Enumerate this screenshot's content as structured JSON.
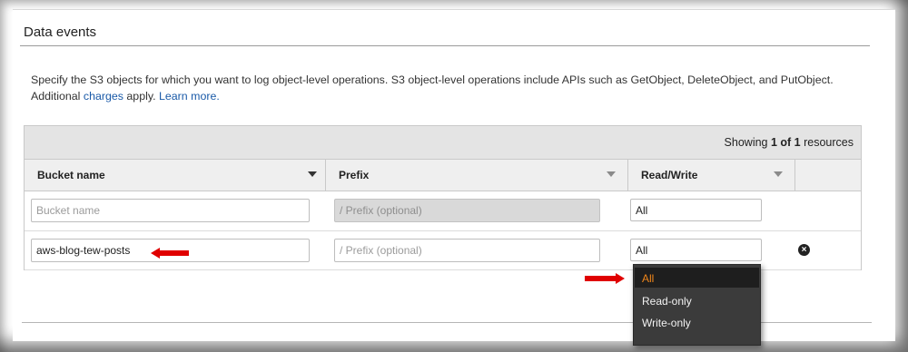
{
  "section": {
    "title": "Data events",
    "description_main": "Specify the S3 objects for which you want to log object-level operations. S3 object-level operations include APIs such as GetObject, DeleteObject, and PutObject. Additional",
    "charges_link": "charges",
    "apply_text": " apply. ",
    "learn_more_link": "Learn more."
  },
  "table": {
    "showing_prefix": "Showing ",
    "showing_count": "1 of 1",
    "showing_suffix": " resources",
    "columns": [
      "Bucket name",
      "Prefix",
      "Read/Write"
    ],
    "new_row": {
      "bucket_placeholder": "Bucket name",
      "prefix_placeholder": "/ Prefix (optional)",
      "read_write": "All"
    },
    "rows": [
      {
        "bucket": "aws-blog-tew-posts",
        "prefix_placeholder": "/ Prefix (optional)",
        "read_write": "All"
      }
    ]
  },
  "dropdown": {
    "options": [
      "All",
      "Read-only",
      "Write-only"
    ],
    "selected": "All"
  },
  "icons": {
    "remove": "remove-circle-icon",
    "sort": "caret-down-icon",
    "annotation": "red-arrow"
  },
  "colors": {
    "link": "#1a5aa8",
    "selected_option": "#f0861a",
    "annotation_arrow": "#e00000",
    "dropdown_bg": "#3b3b3b"
  }
}
